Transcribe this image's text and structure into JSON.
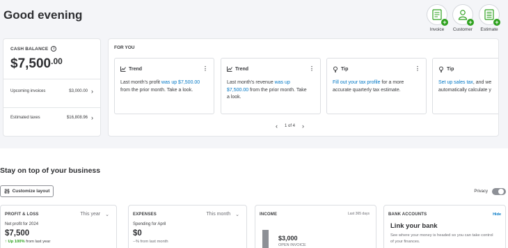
{
  "greeting": "Good evening",
  "quick_actions": [
    {
      "label": "Invoice",
      "icon": "invoice-icon"
    },
    {
      "label": "Customer",
      "icon": "customer-icon"
    },
    {
      "label": "Estimate",
      "icon": "estimate-icon"
    }
  ],
  "cash_balance": {
    "title": "CASH BALANCE",
    "amount_main": "$7,500",
    "amount_cents": ".00",
    "rows": [
      {
        "label": "Upcoming invoices",
        "value": "$3,000.00"
      },
      {
        "label": "Estimated taxes",
        "value": "$16,808.96"
      }
    ]
  },
  "for_you": {
    "title": "FOR YOU",
    "cards": [
      {
        "type": "Trend",
        "text_before": "Last month's profit ",
        "link": "was up $7,500.00",
        "text_after": "from the prior month. Take a look."
      },
      {
        "type": "Trend",
        "text_before": "Last month's revenue ",
        "link": "was up",
        "text_after": "$7,500.00 from the prior month. Take a look.",
        "link2": "$7,500.00",
        "text_after2": " from the prior month. Take",
        "text_line3": "a look."
      },
      {
        "type": "Tip",
        "link": "Fill out your tax profile",
        "text_after": " for a more",
        "text_line2": "accurate quarterly tax estimate."
      },
      {
        "type": "Tip",
        "link": "Set up sales tax",
        "text_after": ", and we",
        "text_line2": "automatically calculate y"
      }
    ],
    "pager": "1 of 4"
  },
  "section_title": "Stay on top of your business",
  "customize_label": "Customize layout",
  "privacy_label": "Privacy",
  "widgets": {
    "pnl": {
      "title": "PROFIT & LOSS",
      "period": "This year",
      "sub": "Net profit for 2024",
      "amount": "$7,500",
      "note": "↑ Up 100%",
      "note_rest": " from last year"
    },
    "expenses": {
      "title": "EXPENSES",
      "period": "This month",
      "sub": "Spending for April",
      "amount": "$0",
      "note": "--% from last month"
    },
    "income": {
      "title": "INCOME",
      "period": "Last 365 days",
      "amount": "$3,000",
      "label": "OPEN INVOICE"
    },
    "bank": {
      "title": "BANK ACCOUNTS",
      "hide": "Hide",
      "heading": "Link your bank",
      "desc": "See where your money is headed so you can take control of your finances."
    }
  },
  "colors": {
    "accent_link": "#0077c5",
    "success_green": "#2ca01c",
    "background_band": "#f4f5f8"
  }
}
